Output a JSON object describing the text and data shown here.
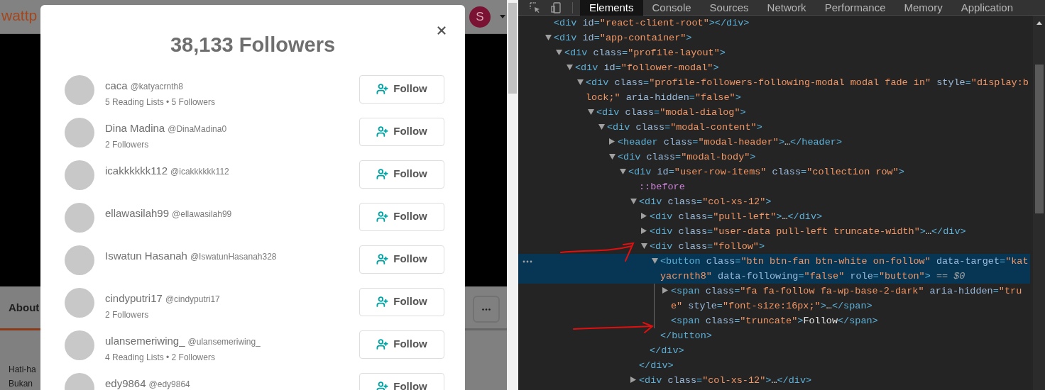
{
  "background_page": {
    "logo": "wattp",
    "avatar_letter": "S",
    "tab": "About",
    "text_lines": [
      "Hati-ha",
      "Bukan"
    ]
  },
  "modal": {
    "title": "38,133 Followers",
    "followers": [
      {
        "name": "caca",
        "handle": "@katyacrnth8",
        "stats": "5 Reading Lists • 5 Followers",
        "button": "Follow"
      },
      {
        "name": "Dina Madina",
        "handle": "@DinaMadina0",
        "stats": "2 Followers",
        "button": "Follow"
      },
      {
        "name": "icakkkkkk112",
        "handle": "@icakkkkkk112",
        "button": "Follow"
      },
      {
        "name": "ellawasilah99",
        "handle": "@ellawasilah99",
        "button": "Follow"
      },
      {
        "name": "Iswatun Hasanah",
        "handle": "@IswatunHasanah328",
        "button": "Follow"
      },
      {
        "name": "cindyputri17",
        "handle": "@cindyputri17",
        "stats": "2 Followers",
        "button": "Follow"
      },
      {
        "name": "ulansemeriwing_",
        "handle": "@ulansemeriwing_",
        "stats": "4 Reading Lists • 2 Followers",
        "button": "Follow"
      },
      {
        "name": "edy9864",
        "handle": "@edy9864",
        "button": "Follow"
      }
    ]
  },
  "devtools": {
    "tabs": [
      {
        "label": "Elements",
        "selected": true
      },
      {
        "label": "Console",
        "selected": false
      },
      {
        "label": "Sources",
        "selected": false
      },
      {
        "label": "Network",
        "selected": false
      },
      {
        "label": "Performance",
        "selected": false
      },
      {
        "label": "Memory",
        "selected": false
      },
      {
        "label": "Application",
        "selected": false
      }
    ],
    "tree": [
      {
        "kind": "leaf",
        "selected": false,
        "line": [
          {
            "kind": "punct",
            "text": "<div"
          },
          {
            "kind": "attr",
            "text": "id"
          },
          {
            "kind": "punct",
            "text": "="
          },
          {
            "kind": "value",
            "text": "\"react-client-root\""
          },
          {
            "kind": "punct",
            "text": "></div>"
          }
        ]
      },
      {
        "kind": "parent",
        "expanded": true,
        "selected": false,
        "line": [
          {
            "kind": "punct",
            "text": "<div"
          },
          {
            "kind": "attr",
            "text": "id"
          },
          {
            "kind": "punct",
            "text": "="
          },
          {
            "kind": "value",
            "text": "\"app-container\""
          },
          {
            "kind": "punct",
            "text": ">"
          }
        ],
        "children": [
          {
            "kind": "parent",
            "expanded": true,
            "selected": false,
            "line": [
              {
                "kind": "punct",
                "text": "<div"
              },
              {
                "kind": "attr",
                "text": "class"
              },
              {
                "kind": "punct",
                "text": "="
              },
              {
                "kind": "value",
                "text": "\"profile-layout\""
              },
              {
                "kind": "punct",
                "text": ">"
              }
            ],
            "children": [
              {
                "kind": "parent",
                "expanded": true,
                "selected": false,
                "line": [
                  {
                    "kind": "punct",
                    "text": "<div"
                  },
                  {
                    "kind": "attr",
                    "text": "id"
                  },
                  {
                    "kind": "punct",
                    "text": "="
                  },
                  {
                    "kind": "value",
                    "text": "\"follower-modal\""
                  },
                  {
                    "kind": "punct",
                    "text": ">"
                  }
                ],
                "children": [
                  {
                    "kind": "parent",
                    "expanded": true,
                    "selected": false,
                    "line": [
                      {
                        "kind": "punct",
                        "text": "<div"
                      },
                      {
                        "kind": "attr",
                        "text": "class"
                      },
                      {
                        "kind": "punct",
                        "text": "="
                      },
                      {
                        "kind": "value",
                        "text": "\"profile-followers-following-modal modal fade in\""
                      },
                      {
                        "kind": "attr",
                        "text": "style"
                      },
                      {
                        "kind": "punct",
                        "text": "="
                      },
                      {
                        "kind": "value",
                        "text": "\"display:block;\""
                      },
                      {
                        "kind": "attr",
                        "text": "aria-hidden"
                      },
                      {
                        "kind": "punct",
                        "text": "="
                      },
                      {
                        "kind": "value",
                        "text": "\"false\""
                      },
                      {
                        "kind": "punct",
                        "text": ">"
                      }
                    ],
                    "children": [
                      {
                        "kind": "parent",
                        "expanded": true,
                        "selected": false,
                        "line": [
                          {
                            "kind": "punct",
                            "text": "<div"
                          },
                          {
                            "kind": "attr",
                            "text": "class"
                          },
                          {
                            "kind": "punct",
                            "text": "="
                          },
                          {
                            "kind": "value",
                            "text": "\"modal-dialog\""
                          },
                          {
                            "kind": "punct",
                            "text": ">"
                          }
                        ],
                        "children": [
                          {
                            "kind": "parent",
                            "expanded": true,
                            "selected": false,
                            "line": [
                              {
                                "kind": "punct",
                                "text": "<div"
                              },
                              {
                                "kind": "attr",
                                "text": "class"
                              },
                              {
                                "kind": "punct",
                                "text": "="
                              },
                              {
                                "kind": "value",
                                "text": "\"modal-content\""
                              },
                              {
                                "kind": "punct",
                                "text": ">"
                              }
                            ],
                            "children": [
                              {
                                "kind": "parent",
                                "expanded": false,
                                "selected": false,
                                "line": [
                                  {
                                    "kind": "punct",
                                    "text": "<header"
                                  },
                                  {
                                    "kind": "attr",
                                    "text": "class"
                                  },
                                  {
                                    "kind": "punct",
                                    "text": "="
                                  },
                                  {
                                    "kind": "value",
                                    "text": "\"modal-header\""
                                  },
                                  {
                                    "kind": "punct",
                                    "text": ">"
                                  },
                                  {
                                    "kind": "text",
                                    "text": "…"
                                  },
                                  {
                                    "kind": "punct",
                                    "text": "</header>"
                                  }
                                ]
                              },
                              {
                                "kind": "parent",
                                "expanded": true,
                                "selected": false,
                                "line": [
                                  {
                                    "kind": "punct",
                                    "text": "<div"
                                  },
                                  {
                                    "kind": "attr",
                                    "text": "class"
                                  },
                                  {
                                    "kind": "punct",
                                    "text": "="
                                  },
                                  {
                                    "kind": "value",
                                    "text": "\"modal-body\""
                                  },
                                  {
                                    "kind": "punct",
                                    "text": ">"
                                  }
                                ],
                                "children": [
                                  {
                                    "kind": "parent",
                                    "expanded": true,
                                    "selected": false,
                                    "line": [
                                      {
                                        "kind": "punct",
                                        "text": "<div"
                                      },
                                      {
                                        "kind": "attr",
                                        "text": "id"
                                      },
                                      {
                                        "kind": "punct",
                                        "text": "="
                                      },
                                      {
                                        "kind": "value",
                                        "text": "\"user-row-items\""
                                      },
                                      {
                                        "kind": "attr",
                                        "text": "class"
                                      },
                                      {
                                        "kind": "punct",
                                        "text": "="
                                      },
                                      {
                                        "kind": "value",
                                        "text": "\"collection row\""
                                      },
                                      {
                                        "kind": "punct",
                                        "text": ">"
                                      }
                                    ],
                                    "children": [
                                      {
                                        "kind": "leaf",
                                        "selected": false,
                                        "line": [
                                          {
                                            "kind": "pseudo",
                                            "text": "::before"
                                          }
                                        ]
                                      },
                                      {
                                        "kind": "parent",
                                        "expanded": true,
                                        "selected": false,
                                        "line": [
                                          {
                                            "kind": "punct",
                                            "text": "<div"
                                          },
                                          {
                                            "kind": "attr",
                                            "text": "class"
                                          },
                                          {
                                            "kind": "punct",
                                            "text": "="
                                          },
                                          {
                                            "kind": "value",
                                            "text": "\"col-xs-12\""
                                          },
                                          {
                                            "kind": "punct",
                                            "text": ">"
                                          }
                                        ],
                                        "children": [
                                          {
                                            "kind": "parent",
                                            "expanded": false,
                                            "selected": false,
                                            "line": [
                                              {
                                                "kind": "punct",
                                                "text": "<div"
                                              },
                                              {
                                                "kind": "attr",
                                                "text": "class"
                                              },
                                              {
                                                "kind": "punct",
                                                "text": "="
                                              },
                                              {
                                                "kind": "value",
                                                "text": "\"pull-left\""
                                              },
                                              {
                                                "kind": "punct",
                                                "text": ">"
                                              },
                                              {
                                                "kind": "text",
                                                "text": "…"
                                              },
                                              {
                                                "kind": "punct",
                                                "text": "</div>"
                                              }
                                            ]
                                          },
                                          {
                                            "kind": "parent",
                                            "expanded": false,
                                            "selected": false,
                                            "line": [
                                              {
                                                "kind": "punct",
                                                "text": "<div"
                                              },
                                              {
                                                "kind": "attr",
                                                "text": "class"
                                              },
                                              {
                                                "kind": "punct",
                                                "text": "="
                                              },
                                              {
                                                "kind": "value",
                                                "text": "\"user-data pull-left truncate-width\""
                                              },
                                              {
                                                "kind": "punct",
                                                "text": ">"
                                              },
                                              {
                                                "kind": "text",
                                                "text": "…"
                                              },
                                              {
                                                "kind": "punct",
                                                "text": "</div>"
                                              }
                                            ]
                                          },
                                          {
                                            "kind": "parent",
                                            "expanded": true,
                                            "selected": false,
                                            "line": [
                                              {
                                                "kind": "punct",
                                                "text": "<div"
                                              },
                                              {
                                                "kind": "attr",
                                                "text": "class"
                                              },
                                              {
                                                "kind": "punct",
                                                "text": "="
                                              },
                                              {
                                                "kind": "value",
                                                "text": "\"follow\""
                                              },
                                              {
                                                "kind": "punct",
                                                "text": ">"
                                              }
                                            ],
                                            "children": [
                                              {
                                                "kind": "parent",
                                                "expanded": true,
                                                "selected": true,
                                                "line": [
                                                  {
                                                    "kind": "punct",
                                                    "text": "<button"
                                                  },
                                                  {
                                                    "kind": "attr",
                                                    "text": "class"
                                                  },
                                                  {
                                                    "kind": "punct",
                                                    "text": "="
                                                  },
                                                  {
                                                    "kind": "value",
                                                    "text": "\"btn btn-fan btn-white on-follow\""
                                                  },
                                                  {
                                                    "kind": "attr",
                                                    "text": "data-target"
                                                  },
                                                  {
                                                    "kind": "punct",
                                                    "text": "="
                                                  },
                                                  {
                                                    "kind": "value",
                                                    "text": "\"katyacrnth8\""
                                                  },
                                                  {
                                                    "kind": "attr",
                                                    "text": "data-following"
                                                  },
                                                  {
                                                    "kind": "punct",
                                                    "text": "="
                                                  },
                                                  {
                                                    "kind": "value",
                                                    "text": "\"false\""
                                                  },
                                                  {
                                                    "kind": "attr",
                                                    "text": "role"
                                                  },
                                                  {
                                                    "kind": "punct",
                                                    "text": "="
                                                  },
                                                  {
                                                    "kind": "value",
                                                    "text": "\"button\""
                                                  },
                                                  {
                                                    "kind": "punct",
                                                    "text": ">"
                                                  },
                                                  {
                                                    "kind": "comment",
                                                    "text": "== $0"
                                                  }
                                                ],
                                                "children": [
                                                  {
                                                    "kind": "parent",
                                                    "expanded": false,
                                                    "selected": false,
                                                    "line": [
                                                      {
                                                        "kind": "punct",
                                                        "text": "<span"
                                                      },
                                                      {
                                                        "kind": "attr",
                                                        "text": "class"
                                                      },
                                                      {
                                                        "kind": "punct",
                                                        "text": "="
                                                      },
                                                      {
                                                        "kind": "value",
                                                        "text": "\"fa fa-follow fa-wp-base-2-dark\""
                                                      },
                                                      {
                                                        "kind": "attr",
                                                        "text": "aria-hidden"
                                                      },
                                                      {
                                                        "kind": "punct",
                                                        "text": "="
                                                      },
                                                      {
                                                        "kind": "value",
                                                        "text": "\"true\""
                                                      },
                                                      {
                                                        "kind": "attr",
                                                        "text": "style"
                                                      },
                                                      {
                                                        "kind": "punct",
                                                        "text": "="
                                                      },
                                                      {
                                                        "kind": "value",
                                                        "text": "\"font-size:16px;\""
                                                      },
                                                      {
                                                        "kind": "punct",
                                                        "text": ">"
                                                      },
                                                      {
                                                        "kind": "text",
                                                        "text": "…"
                                                      },
                                                      {
                                                        "kind": "punct",
                                                        "text": "</span>"
                                                      }
                                                    ]
                                                  },
                                                  {
                                                    "kind": "leaf",
                                                    "selected": false,
                                                    "line": [
                                                      {
                                                        "kind": "punct",
                                                        "text": "<span"
                                                      },
                                                      {
                                                        "kind": "attr",
                                                        "text": "class"
                                                      },
                                                      {
                                                        "kind": "punct",
                                                        "text": "="
                                                      },
                                                      {
                                                        "kind": "value",
                                                        "text": "\"truncate\""
                                                      },
                                                      {
                                                        "kind": "punct",
                                                        "text": ">"
                                                      },
                                                      {
                                                        "kind": "text",
                                                        "text": "Follow"
                                                      },
                                                      {
                                                        "kind": "punct",
                                                        "text": "</span>"
                                                      }
                                                    ]
                                                  }
                                                ],
                                                "close": [
                                                  {
                                                    "kind": "punct",
                                                    "text": "</button>"
                                                  }
                                                ]
                                              }
                                            ],
                                            "close": [
                                              {
                                                "kind": "punct",
                                                "text": "</div>"
                                              }
                                            ]
                                          }
                                        ],
                                        "close": [
                                          {
                                            "kind": "punct",
                                            "text": "</div>"
                                          }
                                        ]
                                      },
                                      {
                                        "kind": "parent",
                                        "expanded": false,
                                        "selected": false,
                                        "line": [
                                          {
                                            "kind": "punct",
                                            "text": "<div"
                                          },
                                          {
                                            "kind": "attr",
                                            "text": "class"
                                          },
                                          {
                                            "kind": "punct",
                                            "text": "="
                                          },
                                          {
                                            "kind": "value",
                                            "text": "\"col-xs-12\""
                                          },
                                          {
                                            "kind": "punct",
                                            "text": ">"
                                          },
                                          {
                                            "kind": "text",
                                            "text": "…"
                                          },
                                          {
                                            "kind": "punct",
                                            "text": "</div>"
                                          }
                                        ]
                                      }
                                    ]
                                  }
                                ]
                              }
                            ]
                          }
                        ]
                      }
                    ]
                  }
                ]
              }
            ]
          }
        ]
      }
    ]
  }
}
